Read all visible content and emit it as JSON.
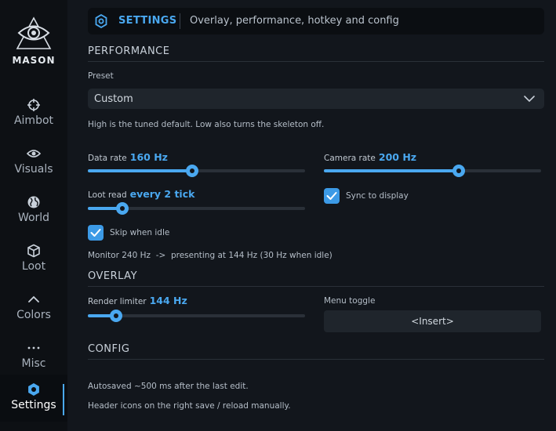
{
  "brand": {
    "name": "MASON"
  },
  "sidebar": {
    "items": [
      {
        "label": "Aimbot",
        "icon": "crosshair-icon"
      },
      {
        "label": "Visuals",
        "icon": "eye-icon"
      },
      {
        "label": "World",
        "icon": "globe-icon"
      },
      {
        "label": "Loot",
        "icon": "box-icon"
      },
      {
        "label": "Colors",
        "icon": "chevron-up-icon"
      },
      {
        "label": "Misc",
        "icon": "ellipsis-icon"
      },
      {
        "label": "Settings",
        "icon": "gear-icon",
        "active": true
      }
    ]
  },
  "header": {
    "title": "SETTINGS",
    "subtitle": "Overlay, performance, hotkey and config"
  },
  "performance": {
    "title": "PERFORMANCE",
    "preset_label": "Preset",
    "preset_value": "Custom",
    "preset_hint": "High is the tuned default. Low also turns the skeleton off.",
    "data_rate": {
      "label": "Data rate",
      "value": "160 Hz",
      "fraction": 0.48
    },
    "camera_rate": {
      "label": "Camera rate",
      "value": "200 Hz",
      "fraction": 0.62
    },
    "loot_read": {
      "label": "Loot read",
      "value": "every 2 tick",
      "fraction": 0.16
    },
    "sync_to_display": {
      "label": "Sync to display",
      "checked": true
    },
    "skip_when_idle": {
      "label": "Skip when idle",
      "checked": true
    },
    "monitor_info": "Monitor 240 Hz  ->  presenting at 144 Hz (30 Hz when idle)"
  },
  "overlay": {
    "title": "OVERLAY",
    "render_limiter": {
      "label": "Render limiter",
      "value": "144 Hz",
      "fraction": 0.13
    },
    "menu_toggle_label": "Menu toggle",
    "menu_toggle_value": "<Insert>"
  },
  "config": {
    "title": "CONFIG",
    "note1": "Autosaved ~500 ms after the last edit.",
    "note2": "Header icons on the right save / reload manually."
  },
  "colors": {
    "accent": "#4aa8f0",
    "background": "#12161c",
    "sidebar": "#0d1014"
  }
}
